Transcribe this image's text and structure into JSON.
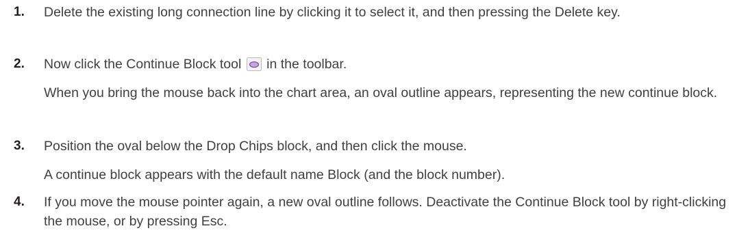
{
  "steps": [
    {
      "number": "1.",
      "text": "Delete the existing long connection line by clicking it to select it, and then pressing the Delete key."
    },
    {
      "number": "2.",
      "text_before_icon": "Now click the Continue Block tool",
      "icon": "continue-block-tool-icon",
      "text_after_icon": "in the toolbar.",
      "followup": "When you bring the mouse back into the chart area, an oval outline appears, representing the new continue block."
    },
    {
      "number": "3.",
      "text": "Position the oval below the Drop Chips block, and then click the mouse.",
      "followup": "A continue block appears with the default name Block (and the block number)."
    },
    {
      "number": "4.",
      "text": "If you move the mouse pointer again, a new oval outline follows. Deactivate the Continue Block tool by right-clicking the mouse, or by pressing Esc."
    }
  ],
  "colors": {
    "text": "#404040",
    "number": "#231f20",
    "icon_fill": "#c9a3e6",
    "icon_border": "#7a4fa5"
  }
}
